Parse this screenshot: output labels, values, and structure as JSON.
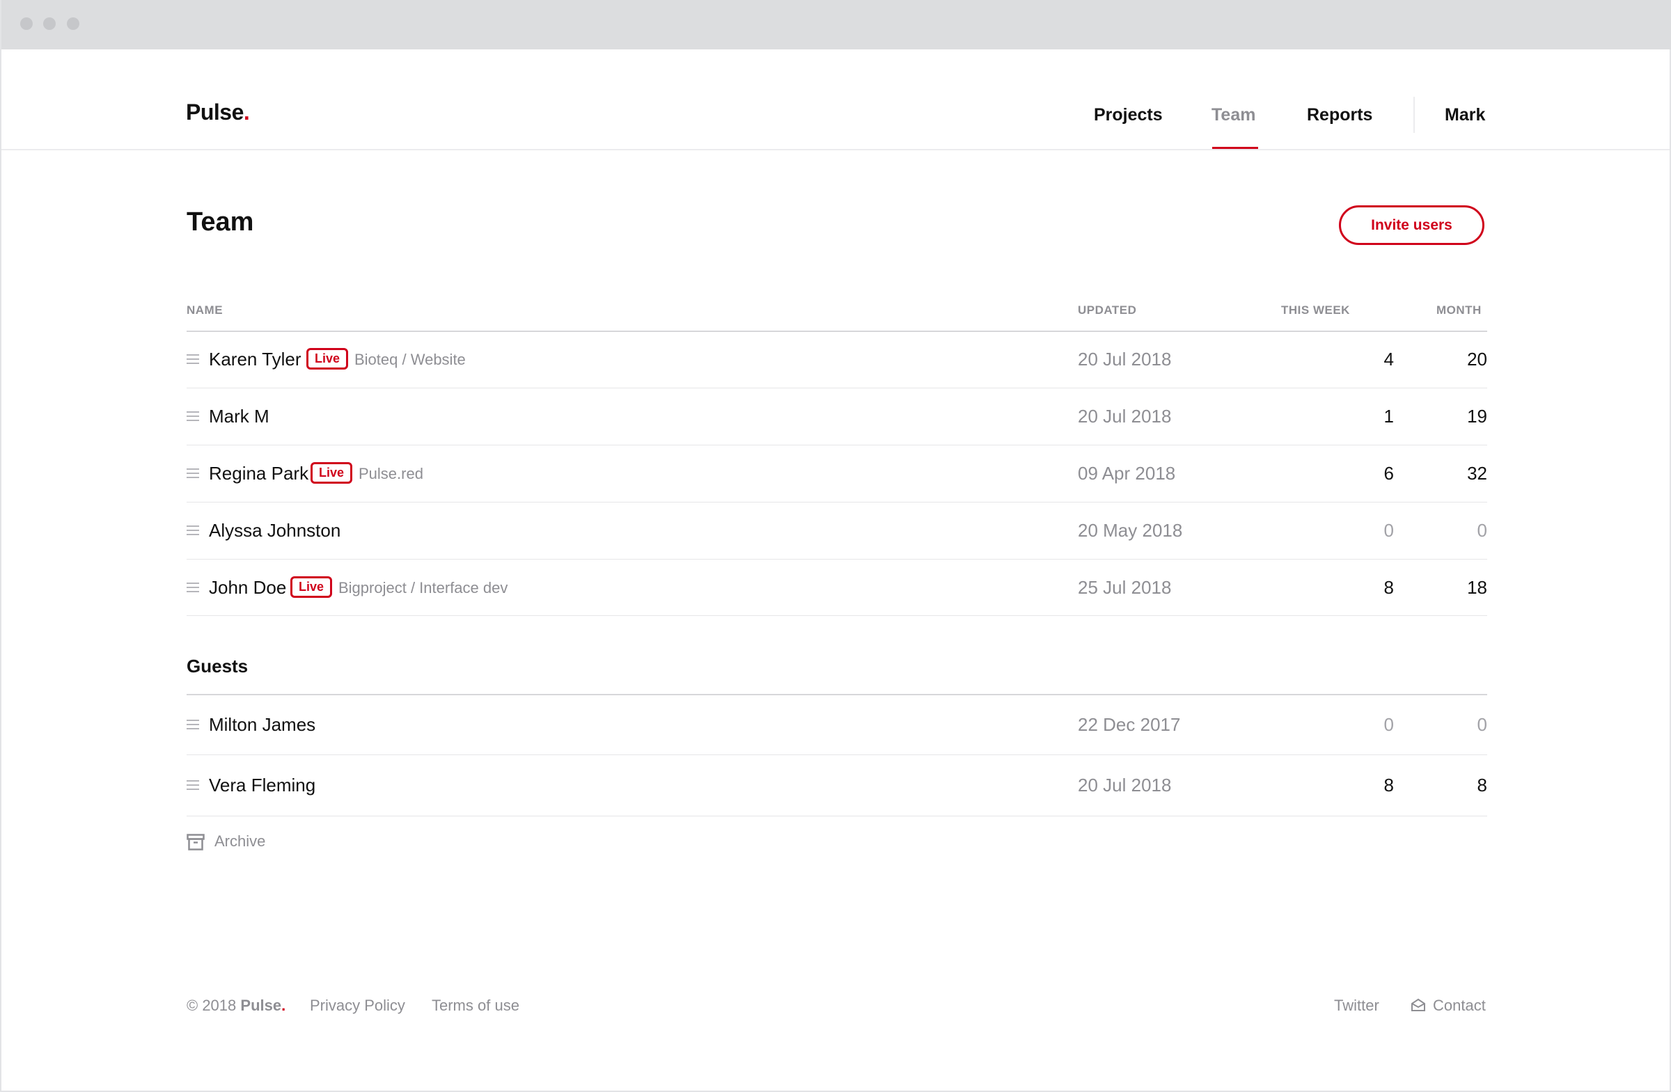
{
  "brand": {
    "name": "Pulse",
    "dot": "."
  },
  "nav": {
    "items": [
      {
        "label": "Projects"
      },
      {
        "label": "Team",
        "active": true
      },
      {
        "label": "Reports"
      }
    ],
    "user": "Mark"
  },
  "page": {
    "title": "Team",
    "invite_label": "Invite users"
  },
  "table": {
    "headers": {
      "name": "NAME",
      "updated": "UPDATED",
      "week": "THIS WEEK",
      "month": "MONTH"
    },
    "rows": [
      {
        "name": "Karen Tyler",
        "live": "Live",
        "project": "Bioteq / Website",
        "updated": "20 Jul 2018",
        "week": "4",
        "month": "20"
      },
      {
        "name": "Mark M",
        "updated": "20 Jul 2018",
        "week": "1",
        "month": "19"
      },
      {
        "name": "Regina Park",
        "live": "Live",
        "project": "Pulse.red",
        "updated": "09 Apr 2018",
        "week": "6",
        "month": "32"
      },
      {
        "name": "Alyssa Johnston",
        "updated": "20 May 2018",
        "week": "0",
        "month": "0"
      },
      {
        "name": "John Doe",
        "live": "Live",
        "project": "Bigproject / Interface dev",
        "updated": "25 Jul 2018",
        "week": "8",
        "month": "18"
      }
    ]
  },
  "guests": {
    "title": "Guests",
    "rows": [
      {
        "name": "Milton James",
        "updated": "22 Dec 2017",
        "week": "0",
        "month": "0"
      },
      {
        "name": "Vera Fleming",
        "updated": "20 Jul 2018",
        "week": "8",
        "month": "8"
      }
    ]
  },
  "archive": {
    "label": "Archive",
    "icon": "archive-icon"
  },
  "footer": {
    "copyright": "© 2018",
    "brand": "Pulse",
    "privacy": "Privacy Policy",
    "terms": "Terms of use",
    "twitter": "Twitter",
    "contact": "Contact"
  },
  "colors": {
    "accent": "#d0021b",
    "muted": "#8e8e93",
    "text": "#111111"
  }
}
